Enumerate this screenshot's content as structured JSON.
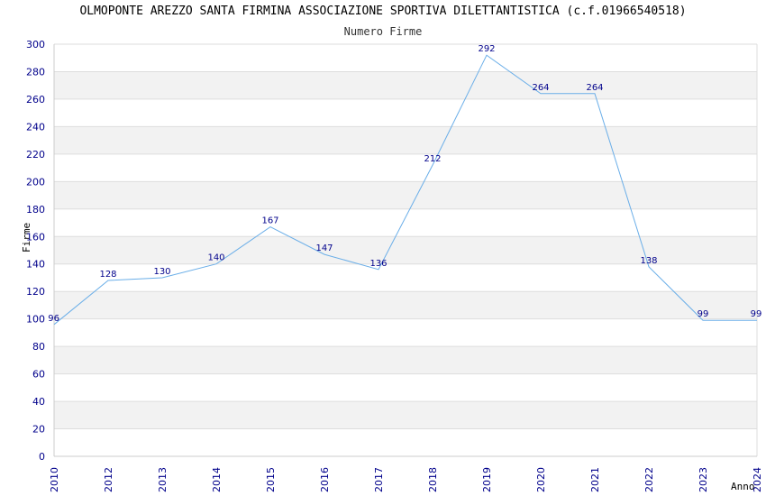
{
  "chart_data": {
    "type": "line",
    "title": "OLMOPONTE AREZZO SANTA FIRMINA ASSOCIAZIONE SPORTIVA DILETTANTISTICA (c.f.01966540518)",
    "subtitle": "Numero Firme",
    "xlabel": "Anno",
    "ylabel": "Firme",
    "x": [
      2010,
      2012,
      2013,
      2014,
      2015,
      2016,
      2017,
      2018,
      2019,
      2020,
      2021,
      2022,
      2023,
      2024
    ],
    "y": [
      96,
      128,
      130,
      140,
      167,
      147,
      136,
      212,
      292,
      264,
      264,
      138,
      99,
      99
    ],
    "ylim": [
      0,
      300
    ],
    "ytick_step": 20,
    "grid": true,
    "colors": {
      "line": "#6aaee8",
      "band": "#f2f2f2",
      "gridline": "#dddddd",
      "tick_text": "#00008b"
    }
  }
}
